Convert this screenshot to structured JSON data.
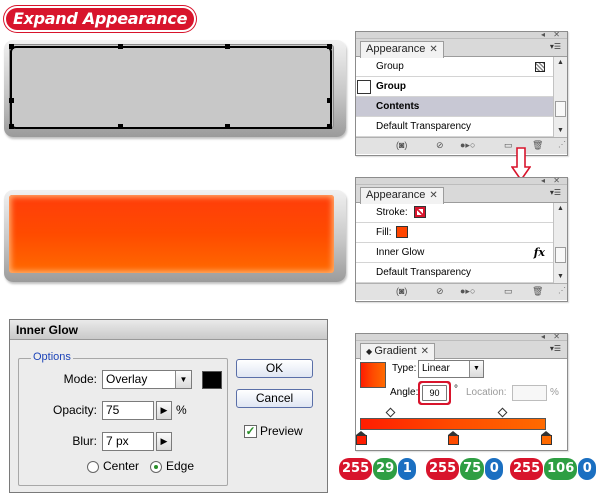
{
  "title": "Expand Appearance",
  "colors": {
    "accent_red": "#d8142c",
    "rgb_green": "#2e9e43",
    "rgb_blue": "#1a6fc1",
    "fill_orange": "#ff4b00"
  },
  "appearance_panel_1": {
    "tab_label": "Appearance",
    "rows": [
      {
        "label": "Group",
        "icon": "checker-icon"
      },
      {
        "label": "Group"
      },
      {
        "label": "Contents"
      },
      {
        "label": "Default Transparency"
      }
    ]
  },
  "appearance_panel_2": {
    "tab_label": "Appearance",
    "rows": [
      {
        "label": "Stroke:"
      },
      {
        "label": "Fill:"
      },
      {
        "label": "Inner Glow",
        "icon": "fx-icon",
        "glyph": "fx"
      },
      {
        "label": "Default Transparency"
      }
    ]
  },
  "inner_glow_dialog": {
    "title": "Inner Glow",
    "options_legend": "Options",
    "mode_label": "Mode:",
    "mode_value": "Overlay",
    "opacity_label": "Opacity:",
    "opacity_value": "75",
    "opacity_unit": "%",
    "blur_label": "Blur:",
    "blur_value": "7 px",
    "center_label": "Center",
    "edge_label": "Edge",
    "selected_source": "Edge",
    "ok_label": "OK",
    "cancel_label": "Cancel",
    "preview_label": "Preview",
    "preview_checked": true
  },
  "gradient_panel": {
    "tab_label": "Gradient",
    "type_label": "Type:",
    "type_value": "Linear",
    "angle_label": "Angle:",
    "angle_value": "90",
    "degree_symbol": "°",
    "location_label": "Location:",
    "location_unit": "%"
  },
  "rgb_values": [
    {
      "r": "255",
      "g": "29",
      "b": "1"
    },
    {
      "r": "255",
      "g": "75",
      "b": "0"
    },
    {
      "r": "255",
      "g": "106",
      "b": "0"
    }
  ]
}
